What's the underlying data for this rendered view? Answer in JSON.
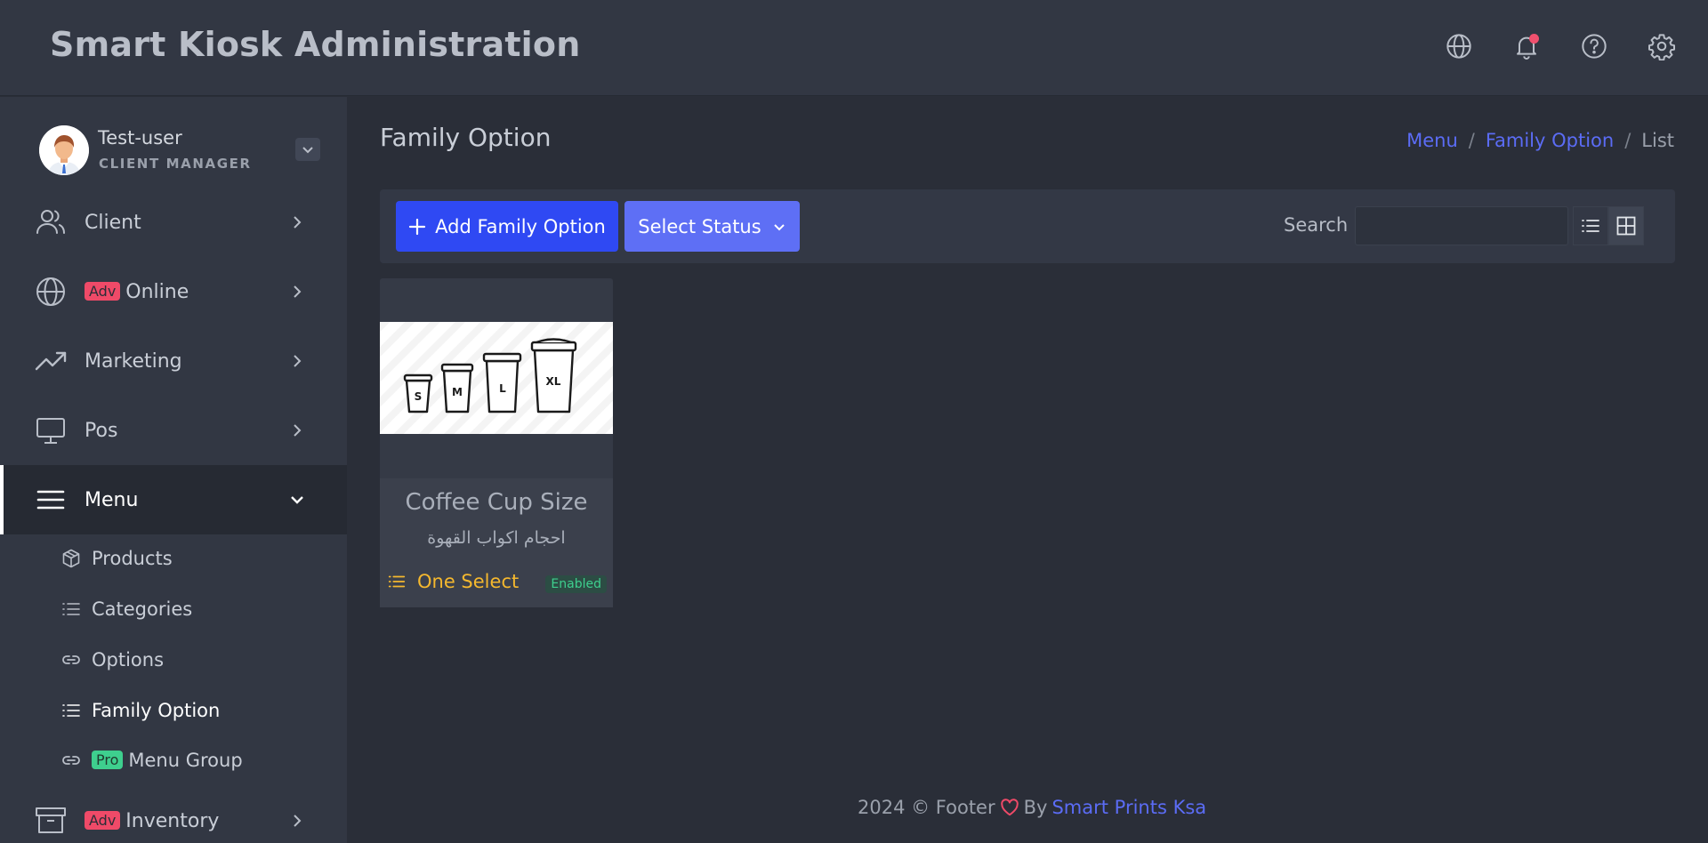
{
  "header": {
    "app_title": "Smart Kiosk Administration",
    "icons": [
      "globe-icon",
      "bell-icon",
      "help-icon",
      "gear-icon"
    ]
  },
  "user": {
    "name": "Test-user",
    "role": "CLIENT MANAGER"
  },
  "sidebar": {
    "items": [
      {
        "label": "Client",
        "badge": ""
      },
      {
        "label": "Online",
        "badge": "Adv"
      },
      {
        "label": "Marketing",
        "badge": ""
      },
      {
        "label": "Pos",
        "badge": ""
      },
      {
        "label": "Menu",
        "badge": ""
      },
      {
        "label": "Inventory",
        "badge": "Adv"
      }
    ],
    "menu_sub": [
      {
        "label": "Products",
        "badge": ""
      },
      {
        "label": "Categories",
        "badge": ""
      },
      {
        "label": "Options",
        "badge": ""
      },
      {
        "label": "Family Option",
        "badge": ""
      },
      {
        "label": "Menu Group",
        "badge": "Pro"
      }
    ]
  },
  "page": {
    "title": "Family Option",
    "breadcrumb": [
      "Menu",
      "Family Option",
      "List"
    ]
  },
  "toolbar": {
    "add_label": "Add Family Option",
    "status_label": "Select Status",
    "search_label": "Search",
    "search_value": ""
  },
  "cards": [
    {
      "name": "Coffee Cup Size",
      "name_ar": "احجام اكواب القهوة",
      "type": "One Select",
      "status": "Enabled",
      "cup_labels": [
        "S",
        "M",
        "L",
        "XL"
      ]
    }
  ],
  "footer": {
    "text": "2024 © Footer",
    "by": "By",
    "link": "Smart Prints Ksa"
  },
  "colors": {
    "primary": "#2f49f3",
    "secondary_button": "#5e6ff5",
    "link": "#5b6cf5",
    "warning": "#f5b82e",
    "success": "#3ecf8e",
    "danger": "#ef4a68"
  }
}
